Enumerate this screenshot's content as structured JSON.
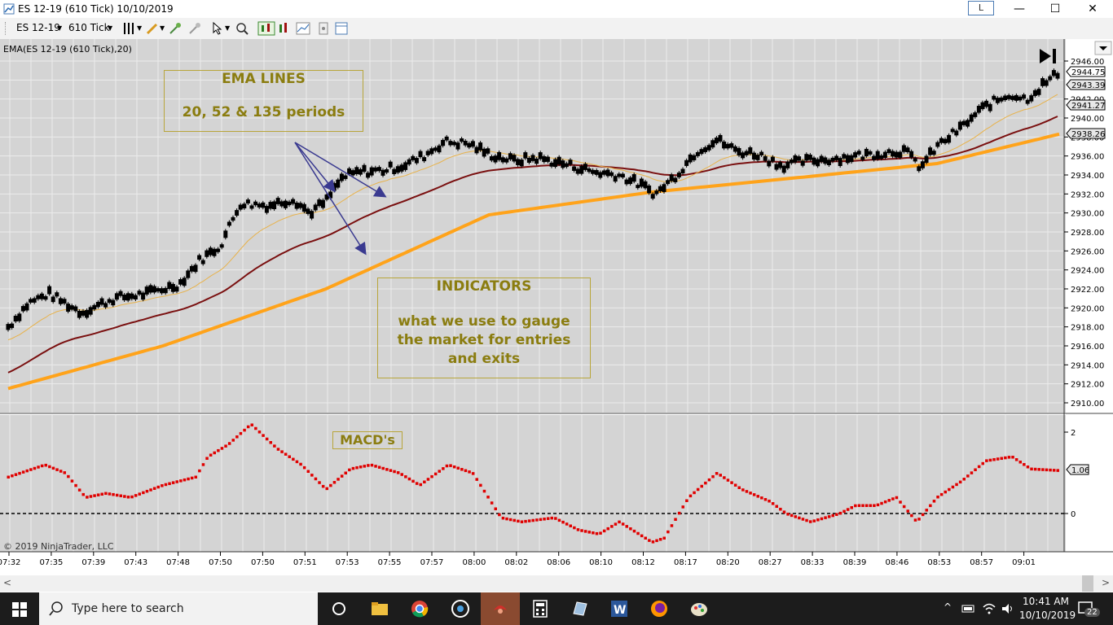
{
  "window": {
    "title": "ES 12-19 (610 Tick)  10/10/2019",
    "layout_btn": "L",
    "minimize_glyph": "—",
    "maximize_glyph": "☐",
    "close_glyph": "✕"
  },
  "toolbar": {
    "instrument": "ES 12-19",
    "interval": "610 Tick"
  },
  "chart": {
    "indicator_label": "EMA(ES 12-19 (610 Tick),20)",
    "copyright": "© 2019 NinjaTrader, LLC",
    "annotation_ema_title": "EMA LINES",
    "annotation_ema_sub": "20, 52 & 135 periods",
    "annotation_ind_title": "INDICATORS",
    "annotation_ind_l1": "what we use to gauge",
    "annotation_ind_l2": "the market for entries",
    "annotation_ind_l3": "and exits",
    "annotation_macd": "MACD's",
    "price_axis": [
      "2946.00",
      "2942.00",
      "2940.00",
      "2938.00",
      "2936.00",
      "2934.00",
      "2932.00",
      "2930.00",
      "2928.00",
      "2926.00",
      "2924.00",
      "2922.00",
      "2920.00",
      "2918.00",
      "2916.00",
      "2914.00",
      "2912.00",
      "2910.00"
    ],
    "price_tags": [
      "2944.75",
      "2943.39",
      "2941.27",
      "2938.26"
    ],
    "macd_axis": [
      "2",
      "0"
    ],
    "macd_tag": "1.06",
    "time_axis": [
      "07:32",
      "07:35",
      "07:39",
      "07:43",
      "07:48",
      "07:50",
      "07:50",
      "07:51",
      "07:53",
      "07:55",
      "07:57",
      "08:00",
      "08:02",
      "08:06",
      "08:10",
      "08:12",
      "08:17",
      "08:20",
      "08:27",
      "08:33",
      "08:39",
      "08:46",
      "08:53",
      "08:57",
      "09:01"
    ],
    "colors": {
      "ema20": "#e8b24a",
      "ema52": "#7a1010",
      "ema135": "#ffa31a",
      "macd": "#e00000",
      "arrow": "#3a3a90",
      "background": "#d4d4d4"
    }
  },
  "chart_data": {
    "type": "line",
    "series": [
      {
        "name": "EMA(ES 12-19 (610 Tick),20)",
        "values": [
          2944.75
        ]
      }
    ],
    "price_tags": [
      2944.75,
      2943.39,
      2941.27,
      2938.26
    ],
    "ylim": [
      2910,
      2946
    ],
    "macd_last": 1.06,
    "macd_ylim": [
      -1.2,
      2.2
    ]
  },
  "taskbar": {
    "search_placeholder": "Type here to search",
    "time": "10:41 AM",
    "date": "10/10/2019",
    "notif_count": "22"
  }
}
